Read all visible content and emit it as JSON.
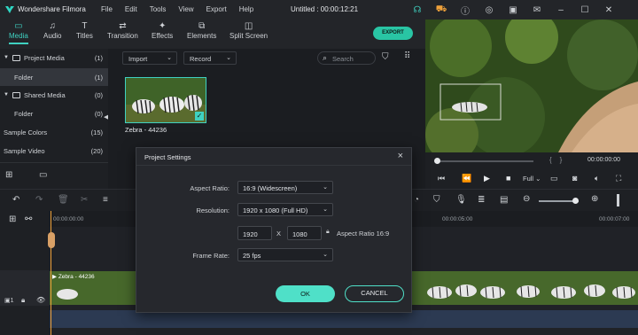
{
  "app": {
    "name": "Wondershare Filmora",
    "document": "Untitled : 00:00:12:21"
  },
  "menu": [
    "File",
    "Edit",
    "Tools",
    "View",
    "Export",
    "Help"
  ],
  "tabs": [
    {
      "label": "Media",
      "icon": "folder-icon",
      "active": true
    },
    {
      "label": "Audio",
      "icon": "music-icon"
    },
    {
      "label": "Titles",
      "icon": "text-icon"
    },
    {
      "label": "Transition",
      "icon": "transition-icon"
    },
    {
      "label": "Effects",
      "icon": "sparkle-icon"
    },
    {
      "label": "Elements",
      "icon": "elements-icon"
    },
    {
      "label": "Split Screen",
      "icon": "split-screen-icon"
    }
  ],
  "export_label": "EXPORT",
  "library": {
    "items": [
      {
        "label": "Project Media",
        "count": "(1)"
      },
      {
        "label": "Folder",
        "count": "(1)"
      },
      {
        "label": "Shared Media",
        "count": "(0)"
      },
      {
        "label": "Folder",
        "count": "(0)"
      },
      {
        "label": "Sample Colors",
        "count": "(15)"
      },
      {
        "label": "Sample Video",
        "count": "(20)"
      }
    ]
  },
  "media_toolbar": {
    "import": "Import",
    "record": "Record",
    "search_placeholder": "Search"
  },
  "clip": {
    "name": "Zebra - 44236"
  },
  "preview": {
    "timecode": "00:00:00:00",
    "quality": "Full",
    "brackets": "{    }"
  },
  "timeline": {
    "ruler": [
      "00:00:00:00",
      "00:00:05:00",
      "00:00:07:00"
    ],
    "track_clip": "Zebra - 44236"
  },
  "dialog": {
    "title": "Project Settings",
    "aspect_label": "Aspect Ratio:",
    "aspect_value": "16:9 (Widescreen)",
    "resolution_label": "Resolution:",
    "resolution_value": "1920 x 1080 (Full HD)",
    "width": "1920",
    "x": "X",
    "height": "1080",
    "aspect_note": "Aspect Ratio 16:9",
    "framerate_label": "Frame Rate:",
    "framerate_value": "25 fps",
    "ok": "OK",
    "cancel": "CANCEL"
  },
  "colors": {
    "accent": "#3fd1c1",
    "button": "#4fe0c8"
  }
}
